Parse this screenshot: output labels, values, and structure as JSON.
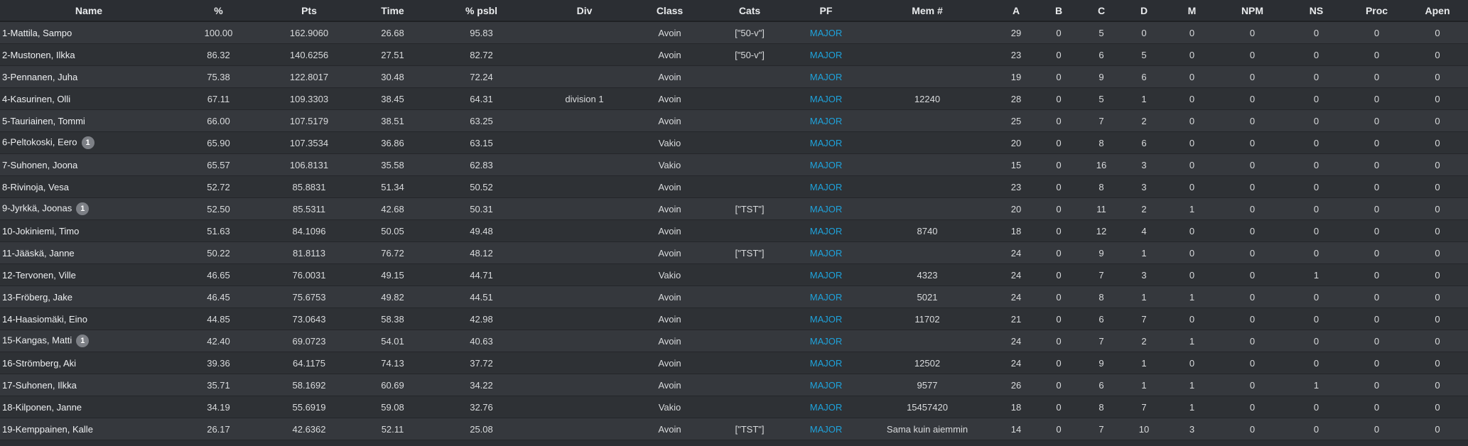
{
  "colors": {
    "accent_link": "#1ea3dc",
    "row_odd": "#35383d",
    "row_even": "#2e3135",
    "badge": "#7d8086"
  },
  "columns": [
    "Name",
    "%",
    "Pts",
    "Time",
    "% psbl",
    "Div",
    "Class",
    "Cats",
    "PF",
    "Mem #",
    "A",
    "B",
    "C",
    "D",
    "M",
    "NPM",
    "NS",
    "Proc",
    "Apen"
  ],
  "rows": [
    {
      "name": "1-Mattila, Sampo",
      "badge": "",
      "pct": "100.00",
      "pts": "162.9060",
      "time": "26.68",
      "psbl": "95.83",
      "div": "",
      "cls": "Avoin",
      "cats": "[\"50-v\"]",
      "pf": "MAJOR",
      "mem": "",
      "a": "29",
      "b": "0",
      "c": "5",
      "d": "0",
      "m": "0",
      "npm": "0",
      "ns": "0",
      "proc": "0",
      "apen": "0"
    },
    {
      "name": "2-Mustonen, Ilkka",
      "badge": "",
      "pct": "86.32",
      "pts": "140.6256",
      "time": "27.51",
      "psbl": "82.72",
      "div": "",
      "cls": "Avoin",
      "cats": "[\"50-v\"]",
      "pf": "MAJOR",
      "mem": "",
      "a": "23",
      "b": "0",
      "c": "6",
      "d": "5",
      "m": "0",
      "npm": "0",
      "ns": "0",
      "proc": "0",
      "apen": "0"
    },
    {
      "name": "3-Pennanen, Juha",
      "badge": "",
      "pct": "75.38",
      "pts": "122.8017",
      "time": "30.48",
      "psbl": "72.24",
      "div": "",
      "cls": "Avoin",
      "cats": "",
      "pf": "MAJOR",
      "mem": "",
      "a": "19",
      "b": "0",
      "c": "9",
      "d": "6",
      "m": "0",
      "npm": "0",
      "ns": "0",
      "proc": "0",
      "apen": "0"
    },
    {
      "name": "4-Kasurinen, Olli",
      "badge": "",
      "pct": "67.11",
      "pts": "109.3303",
      "time": "38.45",
      "psbl": "64.31",
      "div": "division 1",
      "cls": "Avoin",
      "cats": "",
      "pf": "MAJOR",
      "mem": "12240",
      "a": "28",
      "b": "0",
      "c": "5",
      "d": "1",
      "m": "0",
      "npm": "0",
      "ns": "0",
      "proc": "0",
      "apen": "0"
    },
    {
      "name": "5-Tauriainen, Tommi",
      "badge": "",
      "pct": "66.00",
      "pts": "107.5179",
      "time": "38.51",
      "psbl": "63.25",
      "div": "",
      "cls": "Avoin",
      "cats": "",
      "pf": "MAJOR",
      "mem": "",
      "a": "25",
      "b": "0",
      "c": "7",
      "d": "2",
      "m": "0",
      "npm": "0",
      "ns": "0",
      "proc": "0",
      "apen": "0"
    },
    {
      "name": "6-Peltokoski, Eero",
      "badge": "1",
      "pct": "65.90",
      "pts": "107.3534",
      "time": "36.86",
      "psbl": "63.15",
      "div": "",
      "cls": "Vakio",
      "cats": "",
      "pf": "MAJOR",
      "mem": "",
      "a": "20",
      "b": "0",
      "c": "8",
      "d": "6",
      "m": "0",
      "npm": "0",
      "ns": "0",
      "proc": "0",
      "apen": "0"
    },
    {
      "name": "7-Suhonen, Joona",
      "badge": "",
      "pct": "65.57",
      "pts": "106.8131",
      "time": "35.58",
      "psbl": "62.83",
      "div": "",
      "cls": "Vakio",
      "cats": "",
      "pf": "MAJOR",
      "mem": "",
      "a": "15",
      "b": "0",
      "c": "16",
      "d": "3",
      "m": "0",
      "npm": "0",
      "ns": "0",
      "proc": "0",
      "apen": "0"
    },
    {
      "name": "8-Rivinoja, Vesa",
      "badge": "",
      "pct": "52.72",
      "pts": "85.8831",
      "time": "51.34",
      "psbl": "50.52",
      "div": "",
      "cls": "Avoin",
      "cats": "",
      "pf": "MAJOR",
      "mem": "",
      "a": "23",
      "b": "0",
      "c": "8",
      "d": "3",
      "m": "0",
      "npm": "0",
      "ns": "0",
      "proc": "0",
      "apen": "0"
    },
    {
      "name": "9-Jyrkkä, Joonas",
      "badge": "1",
      "pct": "52.50",
      "pts": "85.5311",
      "time": "42.68",
      "psbl": "50.31",
      "div": "",
      "cls": "Avoin",
      "cats": "[\"TST\"]",
      "pf": "MAJOR",
      "mem": "",
      "a": "20",
      "b": "0",
      "c": "11",
      "d": "2",
      "m": "1",
      "npm": "0",
      "ns": "0",
      "proc": "0",
      "apen": "0"
    },
    {
      "name": "10-Jokiniemi, Timo",
      "badge": "",
      "pct": "51.63",
      "pts": "84.1096",
      "time": "50.05",
      "psbl": "49.48",
      "div": "",
      "cls": "Avoin",
      "cats": "",
      "pf": "MAJOR",
      "mem": "8740",
      "a": "18",
      "b": "0",
      "c": "12",
      "d": "4",
      "m": "0",
      "npm": "0",
      "ns": "0",
      "proc": "0",
      "apen": "0"
    },
    {
      "name": "11-Jääskä, Janne",
      "badge": "",
      "pct": "50.22",
      "pts": "81.8113",
      "time": "76.72",
      "psbl": "48.12",
      "div": "",
      "cls": "Avoin",
      "cats": "[\"TST\"]",
      "pf": "MAJOR",
      "mem": "",
      "a": "24",
      "b": "0",
      "c": "9",
      "d": "1",
      "m": "0",
      "npm": "0",
      "ns": "0",
      "proc": "0",
      "apen": "0"
    },
    {
      "name": "12-Tervonen, Ville",
      "badge": "",
      "pct": "46.65",
      "pts": "76.0031",
      "time": "49.15",
      "psbl": "44.71",
      "div": "",
      "cls": "Vakio",
      "cats": "",
      "pf": "MAJOR",
      "mem": "4323",
      "a": "24",
      "b": "0",
      "c": "7",
      "d": "3",
      "m": "0",
      "npm": "0",
      "ns": "1",
      "proc": "0",
      "apen": "0"
    },
    {
      "name": "13-Fröberg, Jake",
      "badge": "",
      "pct": "46.45",
      "pts": "75.6753",
      "time": "49.82",
      "psbl": "44.51",
      "div": "",
      "cls": "Avoin",
      "cats": "",
      "pf": "MAJOR",
      "mem": "5021",
      "a": "24",
      "b": "0",
      "c": "8",
      "d": "1",
      "m": "1",
      "npm": "0",
      "ns": "0",
      "proc": "0",
      "apen": "0"
    },
    {
      "name": "14-Haasiomäki, Eino",
      "badge": "",
      "pct": "44.85",
      "pts": "73.0643",
      "time": "58.38",
      "psbl": "42.98",
      "div": "",
      "cls": "Avoin",
      "cats": "",
      "pf": "MAJOR",
      "mem": "11702",
      "a": "21",
      "b": "0",
      "c": "6",
      "d": "7",
      "m": "0",
      "npm": "0",
      "ns": "0",
      "proc": "0",
      "apen": "0"
    },
    {
      "name": "15-Kangas, Matti",
      "badge": "1",
      "pct": "42.40",
      "pts": "69.0723",
      "time": "54.01",
      "psbl": "40.63",
      "div": "",
      "cls": "Avoin",
      "cats": "",
      "pf": "MAJOR",
      "mem": "",
      "a": "24",
      "b": "0",
      "c": "7",
      "d": "2",
      "m": "1",
      "npm": "0",
      "ns": "0",
      "proc": "0",
      "apen": "0"
    },
    {
      "name": "16-Strömberg, Aki",
      "badge": "",
      "pct": "39.36",
      "pts": "64.1175",
      "time": "74.13",
      "psbl": "37.72",
      "div": "",
      "cls": "Avoin",
      "cats": "",
      "pf": "MAJOR",
      "mem": "12502",
      "a": "24",
      "b": "0",
      "c": "9",
      "d": "1",
      "m": "0",
      "npm": "0",
      "ns": "0",
      "proc": "0",
      "apen": "0"
    },
    {
      "name": "17-Suhonen, Ilkka",
      "badge": "",
      "pct": "35.71",
      "pts": "58.1692",
      "time": "60.69",
      "psbl": "34.22",
      "div": "",
      "cls": "Avoin",
      "cats": "",
      "pf": "MAJOR",
      "mem": "9577",
      "a": "26",
      "b": "0",
      "c": "6",
      "d": "1",
      "m": "1",
      "npm": "0",
      "ns": "1",
      "proc": "0",
      "apen": "0"
    },
    {
      "name": "18-Kilponen, Janne",
      "badge": "",
      "pct": "34.19",
      "pts": "55.6919",
      "time": "59.08",
      "psbl": "32.76",
      "div": "",
      "cls": "Vakio",
      "cats": "",
      "pf": "MAJOR",
      "mem": "15457420",
      "a": "18",
      "b": "0",
      "c": "8",
      "d": "7",
      "m": "1",
      "npm": "0",
      "ns": "0",
      "proc": "0",
      "apen": "0"
    },
    {
      "name": "19-Kemppainen, Kalle",
      "badge": "",
      "pct": "26.17",
      "pts": "42.6362",
      "time": "52.11",
      "psbl": "25.08",
      "div": "",
      "cls": "Avoin",
      "cats": "[\"TST\"]",
      "pf": "MAJOR",
      "mem": "Sama kuin aiemmin",
      "a": "14",
      "b": "0",
      "c": "7",
      "d": "10",
      "m": "3",
      "npm": "0",
      "ns": "0",
      "proc": "0",
      "apen": "0"
    }
  ]
}
